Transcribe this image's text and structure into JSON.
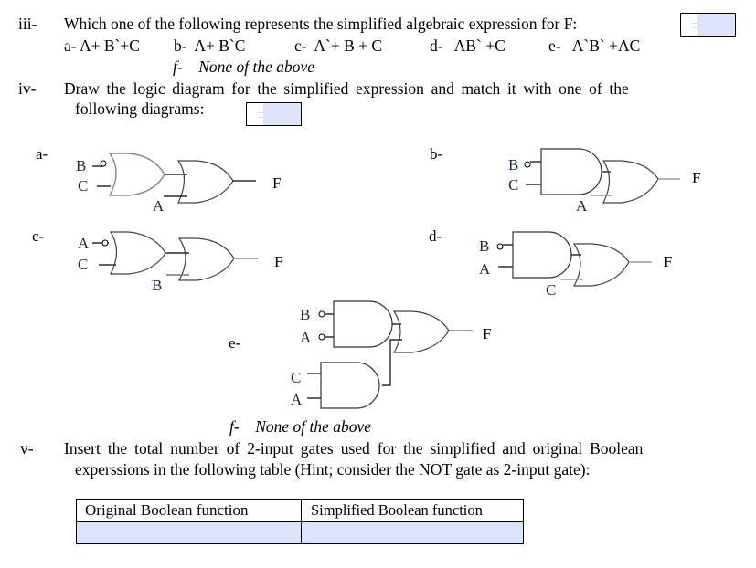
{
  "q3": {
    "num": "iii-",
    "question": "Which one of the following represents the simplified algebraic expression for F:",
    "options": [
      {
        "key": "a-",
        "text": "A+ B`+C"
      },
      {
        "key": "b-",
        "text": "A+ B`C"
      },
      {
        "key": "c-",
        "text": "A`+ B + C"
      },
      {
        "key": "d-",
        "text": "AB` +C"
      },
      {
        "key": "e-",
        "text": "A`B` +AC"
      },
      {
        "key": "f-",
        "text": "None of the above"
      }
    ],
    "answer_value": ""
  },
  "q4": {
    "num": "iv-",
    "question_line1": "Draw the logic diagram for the simplified expression and match it with one of the",
    "question_line2": "following diagrams:",
    "answer_value": "",
    "diagrams": {
      "a": {
        "key": "a-",
        "gate1": "OR",
        "gate1_inputs": [
          "B",
          "C"
        ],
        "inverted": [
          "B"
        ],
        "gate2": "OR",
        "gate2_input": "A",
        "output": "F"
      },
      "b": {
        "key": "b-",
        "gate1": "AND",
        "gate1_inputs": [
          "B",
          "C"
        ],
        "inverted": [
          "B"
        ],
        "gate2": "OR",
        "gate2_input": "A",
        "output": "F"
      },
      "c": {
        "key": "c-",
        "gate1": "OR",
        "gate1_inputs": [
          "A",
          "C"
        ],
        "inverted": [
          "A"
        ],
        "gate2": "OR",
        "gate2_input": "B",
        "output": "F"
      },
      "d": {
        "key": "d-",
        "gate1": "AND",
        "gate1_inputs": [
          "B",
          "A"
        ],
        "inverted": [
          "B"
        ],
        "gate2": "OR",
        "gate2_input": "C",
        "output": "F"
      },
      "e": {
        "key": "e-",
        "gate1": "AND",
        "gate1_inputs": [
          "B",
          "A"
        ],
        "inverted": [
          "B",
          "A"
        ],
        "gate3": "AND",
        "gate3_inputs": [
          "C",
          "A"
        ],
        "gate2": "OR",
        "output": "F"
      }
    },
    "option_f": {
      "key": "f-",
      "text": "None of the above"
    }
  },
  "q5": {
    "num": "v-",
    "question_line1": "Insert the total number of 2-input gates used for the simplified and original Boolean",
    "question_line2": "experssions in the following table (Hint; consider the NOT gate as 2-input gate):",
    "table": {
      "headers": [
        "Original Boolean function",
        "Simplified Boolean function"
      ],
      "values": [
        "",
        ""
      ]
    }
  }
}
